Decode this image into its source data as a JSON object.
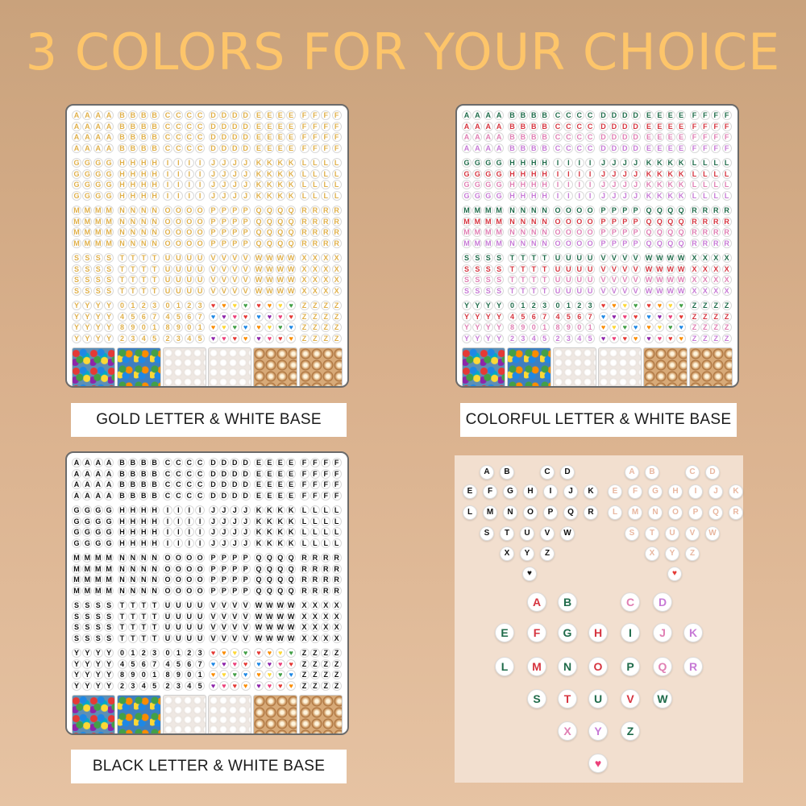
{
  "headline": "3 COLORS FOR YOUR CHOICE",
  "captions": {
    "gold": "GOLD LETTER & WHITE BASE",
    "colorful": "COLORFUL LETTER & WHITE BASE",
    "black": "BLACK LETTER & WHITE BASE"
  },
  "cells": [
    "AAAA",
    "BBBB",
    "CCCC",
    "DDDD",
    "EEEE",
    "FFFF",
    "GGGG",
    "HHHH",
    "IIII",
    "JJJJ",
    "KKKK",
    "LLLL",
    "MMMM",
    "NNNN",
    "OOOO",
    "PPPP",
    "QQQQ",
    "RRRR",
    "SSSS",
    "TTTT",
    "UUUU",
    "VVVV",
    "WWWW",
    "XXXX",
    "YYYY",
    "0123",
    "0123",
    "♥♥♥♥",
    "♥♥♥♥",
    "ZZZZ"
  ],
  "cell_row_sets": {
    "0123": [
      "0123",
      "4567",
      "8901",
      "2345"
    ]
  },
  "colors": {
    "gold": "#e0b04a",
    "black": "#111111",
    "heart_palette": [
      "#e53935",
      "#fb8c00",
      "#fdd835",
      "#43a047",
      "#1e88e5",
      "#8e24aa",
      "#ec407a"
    ],
    "colorful_palette": [
      "#1f6b4a",
      "#d6343f",
      "#e07fb3",
      "#c77ad6"
    ],
    "sample_pastel": [
      "#e8b7e8",
      "#c8e1a0",
      "#f5b3b3",
      "#a8d8e8"
    ]
  },
  "sample_small": [
    [
      "A",
      "B",
      "",
      "C",
      "D"
    ],
    [
      "E",
      "F",
      "G",
      "H",
      "I",
      "J",
      "K"
    ],
    [
      "L",
      "M",
      "N",
      "O",
      "P",
      "Q",
      "R"
    ],
    [
      "S",
      "T",
      "U",
      "V",
      "W"
    ],
    [
      "X",
      "Y",
      "Z"
    ],
    [
      "♥"
    ]
  ],
  "sample_big": [
    [
      "A",
      "B",
      "",
      "C",
      "D"
    ],
    [
      "E",
      "F",
      "G",
      "H",
      "I",
      "J",
      "K"
    ],
    [
      "L",
      "M",
      "N",
      "O",
      "P",
      "Q",
      "R"
    ],
    [
      "S",
      "T",
      "U",
      "V",
      "W"
    ],
    [
      "X",
      "Y",
      "Z"
    ],
    [
      "♥"
    ]
  ]
}
